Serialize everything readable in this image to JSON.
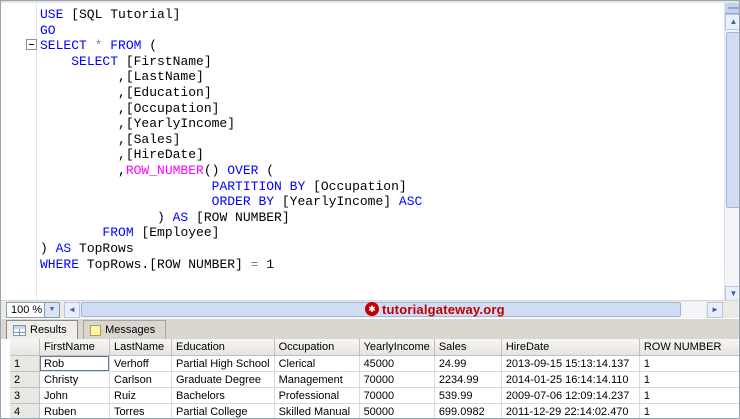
{
  "colors": {
    "keyword": "#0000ff",
    "function": "#ff00ff",
    "operator": "#808080",
    "watermark_red": "#c00000"
  },
  "icons": {
    "scroll_up": "▲",
    "scroll_down": "▼",
    "scroll_left": "◄",
    "scroll_right": "►",
    "dropdown": "▼",
    "logo": "✱"
  },
  "editor": {
    "zoom_value": "100 %",
    "code_lines": [
      [
        [
          "kw",
          "USE"
        ],
        [
          "pl",
          " [SQL Tutorial]"
        ]
      ],
      [
        [
          "kw",
          "GO"
        ]
      ],
      [
        [
          "kw",
          "SELECT"
        ],
        [
          "op",
          " * "
        ],
        [
          "kw",
          "FROM"
        ],
        [
          "pl",
          " ("
        ]
      ],
      [
        [
          "pl",
          "    "
        ],
        [
          "kw",
          "SELECT"
        ],
        [
          "pl",
          " [FirstName]"
        ]
      ],
      [
        [
          "pl",
          "          ,[LastName]"
        ]
      ],
      [
        [
          "pl",
          "          ,[Education]"
        ]
      ],
      [
        [
          "pl",
          "          ,[Occupation]"
        ]
      ],
      [
        [
          "pl",
          "          ,[YearlyIncome]"
        ]
      ],
      [
        [
          "pl",
          "          ,[Sales]"
        ]
      ],
      [
        [
          "pl",
          "          ,[HireDate]"
        ]
      ],
      [
        [
          "pl",
          "          ,"
        ],
        [
          "fn",
          "ROW_NUMBER"
        ],
        [
          "pl",
          "() "
        ],
        [
          "kw",
          "OVER"
        ],
        [
          "pl",
          " ("
        ]
      ],
      [
        [
          "pl",
          "                      "
        ],
        [
          "kw",
          "PARTITION BY"
        ],
        [
          "pl",
          " [Occupation]"
        ]
      ],
      [
        [
          "pl",
          "                      "
        ],
        [
          "kw",
          "ORDER BY"
        ],
        [
          "pl",
          " [YearlyIncome] "
        ],
        [
          "kw",
          "ASC"
        ]
      ],
      [
        [
          "pl",
          "               ) "
        ],
        [
          "kw",
          "AS"
        ],
        [
          "pl",
          " [ROW NUMBER]"
        ]
      ],
      [
        [
          "pl",
          "        "
        ],
        [
          "kw",
          "FROM"
        ],
        [
          "pl",
          " [Employee]"
        ]
      ],
      [
        [
          "pl",
          ") "
        ],
        [
          "kw",
          "AS"
        ],
        [
          "pl",
          " TopRows"
        ]
      ],
      [
        [
          "kw",
          "WHERE"
        ],
        [
          "pl",
          " TopRows.[ROW NUMBER] "
        ],
        [
          "op",
          "="
        ],
        [
          "pl",
          " 1"
        ]
      ]
    ]
  },
  "watermark": {
    "text": "tutorialgateway.org"
  },
  "result_tabs": [
    {
      "label": "Results"
    },
    {
      "label": "Messages"
    }
  ],
  "grid": {
    "columns": [
      "FirstName",
      "LastName",
      "Education",
      "Occupation",
      "YearlyIncome",
      "Sales",
      "HireDate",
      "ROW NUMBER"
    ],
    "rows": [
      {
        "num": "1",
        "cells": [
          "Rob",
          "Verhoff",
          "Partial High School",
          "Clerical",
          "45000",
          "24.99",
          "2013-09-15 15:13:14.137",
          "1"
        ]
      },
      {
        "num": "2",
        "cells": [
          "Christy",
          "Carlson",
          "Graduate Degree",
          "Management",
          "70000",
          "2234.99",
          "2014-01-25 16:14:14.110",
          "1"
        ]
      },
      {
        "num": "3",
        "cells": [
          "John",
          "Ruiz",
          "Bachelors",
          "Professional",
          "70000",
          "539.99",
          "2009-07-06 12:09:14.237",
          "1"
        ]
      },
      {
        "num": "4",
        "cells": [
          "Ruben",
          "Torres",
          "Partial College",
          "Skilled Manual",
          "50000",
          "699.0982",
          "2011-12-29 22:14:02.470",
          "1"
        ]
      }
    ],
    "selected_cell": {
      "row": 0,
      "col": 0
    }
  }
}
